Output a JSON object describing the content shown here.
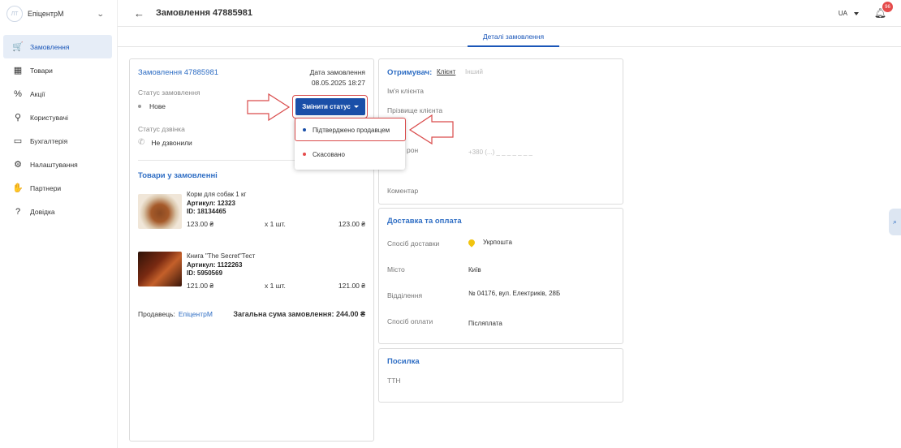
{
  "sidebar": {
    "brand_initials": "ЛТ",
    "brand_name": "ЕпіцентрМ",
    "items": [
      {
        "label": "Замовлення",
        "icon": "cart-icon",
        "glyph": "🛒",
        "active": true
      },
      {
        "label": "Товари",
        "icon": "box-icon",
        "glyph": "▦",
        "active": false
      },
      {
        "label": "Акції",
        "icon": "discount-icon",
        "glyph": "%",
        "active": false
      },
      {
        "label": "Користувачі",
        "icon": "users-icon",
        "glyph": "⚲",
        "active": false
      },
      {
        "label": "Бухгалтерія",
        "icon": "wallet-icon",
        "glyph": "▭",
        "active": false
      },
      {
        "label": "Налаштування",
        "icon": "gear-icon",
        "glyph": "⚙",
        "active": false
      },
      {
        "label": "Партнери",
        "icon": "handshake-icon",
        "glyph": "✋",
        "active": false
      },
      {
        "label": "Довідка",
        "icon": "help-icon",
        "glyph": "?",
        "active": false
      }
    ]
  },
  "header": {
    "title": "Замовлення 47885981",
    "lang": "UA",
    "notifications": "96"
  },
  "tabs": [
    {
      "label": "Деталі замовлення",
      "active": true
    }
  ],
  "order": {
    "number_label": "Замовлення 47885981",
    "date_label": "Дата замовлення",
    "date_value": "08.05.2025 18:27",
    "status_label": "Статус замовлення",
    "status_value": "Нове",
    "change_status_label": "Змінити статус",
    "call_status_label": "Статус дзвінка",
    "call_status_value": "Не дзвонили",
    "goods_title": "Товари у замовленні",
    "products": [
      {
        "name": "Корм для собак 1 кг",
        "sku": "Артикул: 12323",
        "id": "ID: 18134465",
        "price": "123.00 ₴",
        "qty": "x 1 шт.",
        "total": "123.00 ₴"
      },
      {
        "name": "Книга \"The Secret\"Тест",
        "sku": "Артикул: 1122263",
        "id": "ID: 5950569",
        "price": "121.00 ₴",
        "qty": "x 1 шт.",
        "total": "121.00 ₴"
      }
    ],
    "seller_label": "Продавець:",
    "seller_name": "ЕпіцентрМ",
    "total_label": "Загальна сума замовлення: 244.00 ₴"
  },
  "dropdown": {
    "options": [
      {
        "label": "Підтверджено продавцем",
        "color": "#1a4fa8"
      },
      {
        "label": "Скасовано",
        "color": "#e54b4b"
      }
    ]
  },
  "recipient": {
    "title": "Отримувач:",
    "seg_client": "Клієнт",
    "seg_other": "Інший",
    "first_name_label": "Ім'я клієнта",
    "last_name_label": "Прізвище клієнта",
    "phone_label_partial": "рон",
    "phone_mask": "+380 (...) _ _ _  _ _  _ _",
    "comment_label": "Коментар"
  },
  "delivery": {
    "title": "Доставка та оплата",
    "method_label": "Спосіб доставки",
    "method_value": "Укрпошта",
    "city_label": "Місто",
    "city_value": "Київ",
    "branch_label": "Відділення",
    "branch_value": "№ 04176, вул. Електриків, 28Б",
    "payment_label": "Спосіб оплати",
    "payment_value": "Післяплата"
  },
  "parcel": {
    "title": "Посилка",
    "ttn_label": "ТТН"
  },
  "colors": {
    "accent": "#1a4fa8",
    "link": "#2f6ec4",
    "annotation": "#d94b4b"
  }
}
